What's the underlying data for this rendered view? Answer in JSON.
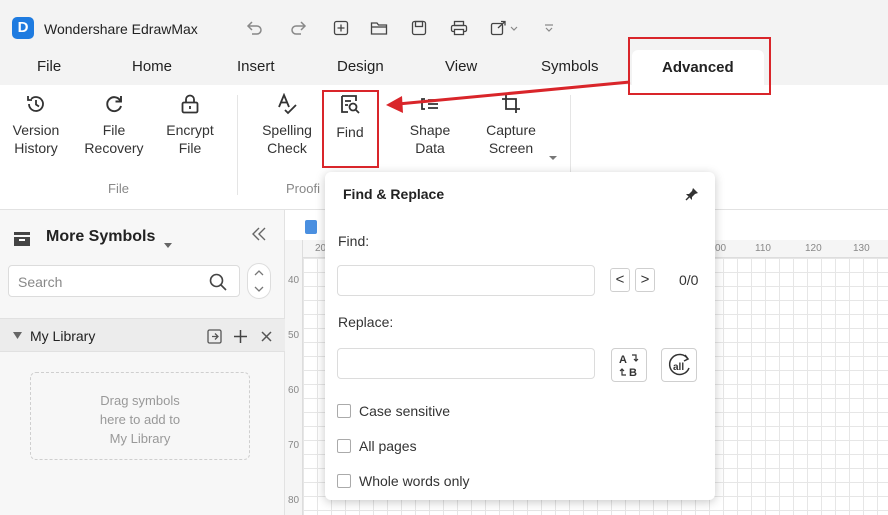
{
  "app": {
    "title": "Wondershare EdrawMax",
    "logo_glyph": "D"
  },
  "quick_access": [
    "undo-icon",
    "redo-icon",
    "new-page-icon",
    "open-folder-icon",
    "save-icon",
    "print-icon",
    "export-icon",
    "customize-icon"
  ],
  "menu": {
    "tabs": [
      {
        "label": "File"
      },
      {
        "label": "Home"
      },
      {
        "label": "Insert"
      },
      {
        "label": "Design"
      },
      {
        "label": "View"
      },
      {
        "label": "Symbols"
      },
      {
        "label": "Advanced",
        "active": true
      }
    ]
  },
  "ribbon": {
    "version_history": "Version\nHistory",
    "file_recovery": "File\nRecovery",
    "encrypt_file": "Encrypt\nFile",
    "spelling_check": "Spelling\nCheck",
    "find": "Find",
    "shape_data": "Shape\nData",
    "capture_screen": "Capture\nScreen",
    "group_file": "File",
    "group_proofing": "Proofi"
  },
  "sidebar": {
    "title": "More Symbols",
    "search_placeholder": "Search",
    "library_label": "My Library",
    "dropzone_text": "Drag symbols\nhere to add to\nMy Library"
  },
  "canvas": {
    "ruler_top_ticks": [
      "20",
      "00",
      "110",
      "120",
      "130"
    ],
    "ruler_left_ticks": [
      "40",
      "50",
      "60",
      "70",
      "80"
    ]
  },
  "find_replace": {
    "title": "Find & Replace",
    "find_label": "Find:",
    "find_value": "",
    "prev_glyph": "<",
    "next_glyph": ">",
    "count": "0/0",
    "replace_label": "Replace:",
    "replace_value": "",
    "options": [
      {
        "label": "Case sensitive",
        "checked": false
      },
      {
        "label": "All pages",
        "checked": false
      },
      {
        "label": "Whole words only",
        "checked": false
      }
    ]
  },
  "annotation": {
    "color": "#d9252a"
  }
}
